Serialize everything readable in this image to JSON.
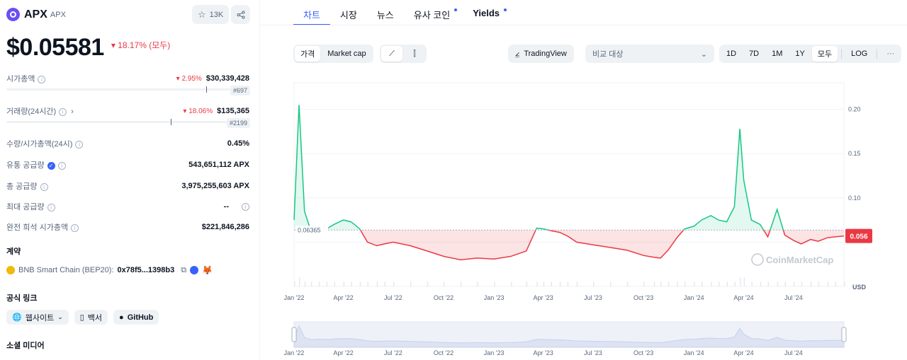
{
  "coin": {
    "name": "APX",
    "symbol": "APX",
    "watchlist_count": "13K",
    "price": "$0.05581",
    "change": "▾ 18.17% (모두)"
  },
  "stats": [
    {
      "label": "시가총액",
      "change": "▾ 2.95%",
      "value": "$30,339,428",
      "rank": "#697"
    },
    {
      "label": "거래량(24시간)",
      "change": "▾ 18.06%",
      "value": "$135,365",
      "rank": "#2199"
    },
    {
      "label": "수량/시가총액(24시)",
      "value": "0.45%"
    },
    {
      "label": "유통 공급량",
      "value": "543,651,112 APX"
    },
    {
      "label": "총 공급량",
      "value": "3,975,255,603 APX"
    },
    {
      "label": "최대 공급량",
      "value": "--"
    },
    {
      "label": "완전 희석 시가총액",
      "value": "$221,846,286"
    }
  ],
  "contract": {
    "heading": "계약",
    "chain": "BNB Smart Chain (BEP20):",
    "address": "0x78f5...1398b3"
  },
  "links": {
    "heading": "공식 링크",
    "website": "웹사이트",
    "whitepaper": "백서",
    "github": "GitHub"
  },
  "social": {
    "heading": "소셜 미디어"
  },
  "tabs": [
    "차트",
    "시장",
    "뉴스",
    "유사 코인",
    "Yields"
  ],
  "controls": {
    "price": "가격",
    "market_cap": "Market cap",
    "tradingview": "TradingView",
    "compare_placeholder": "비교 대상",
    "ranges": [
      "1D",
      "7D",
      "1M",
      "1Y",
      "모두"
    ],
    "log": "LOG",
    "more": "···"
  },
  "chart_data": {
    "type": "area",
    "baseline": 0.06365,
    "baseline_label": "0.06365",
    "current_label": "0.056",
    "unit": "USD",
    "yticks": [
      0.1,
      0.15,
      0.2
    ],
    "ytick_labels": [
      "0.10",
      "0.15",
      "0.20"
    ],
    "xticks": [
      "Jan '22",
      "Apr '22",
      "Jul '22",
      "Oct '22",
      "Jan '23",
      "Apr '23",
      "Jul '23",
      "Oct '23",
      "Jan '24",
      "Apr '24",
      "Jul '24"
    ],
    "watermark": "CoinMarketCap",
    "x": [
      "2022-01-01",
      "2022-01-10",
      "2022-01-20",
      "2022-02-01",
      "2022-02-15",
      "2022-03-01",
      "2022-03-15",
      "2022-04-01",
      "2022-04-15",
      "2022-05-01",
      "2022-05-15",
      "2022-06-01",
      "2022-06-15",
      "2022-07-01",
      "2022-08-01",
      "2022-09-01",
      "2022-10-01",
      "2022-11-01",
      "2022-12-01",
      "2023-01-01",
      "2023-02-01",
      "2023-03-01",
      "2023-03-20",
      "2023-04-01",
      "2023-04-15",
      "2023-05-01",
      "2023-05-15",
      "2023-06-01",
      "2023-07-01",
      "2023-08-01",
      "2023-09-01",
      "2023-10-01",
      "2023-10-20",
      "2023-11-01",
      "2023-11-15",
      "2023-12-01",
      "2023-12-15",
      "2024-01-01",
      "2024-01-15",
      "2024-02-01",
      "2024-02-15",
      "2024-03-01",
      "2024-03-15",
      "2024-03-25",
      "2024-04-01",
      "2024-04-15",
      "2024-05-01",
      "2024-05-15",
      "2024-06-01",
      "2024-06-15",
      "2024-07-01",
      "2024-07-15",
      "2024-08-01",
      "2024-08-15",
      "2024-09-01",
      "2024-09-15",
      "2024-10-01"
    ],
    "values": [
      0.075,
      0.205,
      0.085,
      0.062,
      0.068,
      0.065,
      0.07,
      0.075,
      0.073,
      0.065,
      0.05,
      0.046,
      0.048,
      0.05,
      0.046,
      0.04,
      0.034,
      0.03,
      0.032,
      0.031,
      0.034,
      0.04,
      0.066,
      0.065,
      0.063,
      0.061,
      0.057,
      0.05,
      0.047,
      0.044,
      0.041,
      0.035,
      0.033,
      0.032,
      0.041,
      0.055,
      0.065,
      0.068,
      0.075,
      0.08,
      0.075,
      0.073,
      0.09,
      0.178,
      0.12,
      0.075,
      0.07,
      0.056,
      0.087,
      0.058,
      0.052,
      0.048,
      0.053,
      0.051,
      0.055,
      0.056,
      0.057
    ]
  }
}
